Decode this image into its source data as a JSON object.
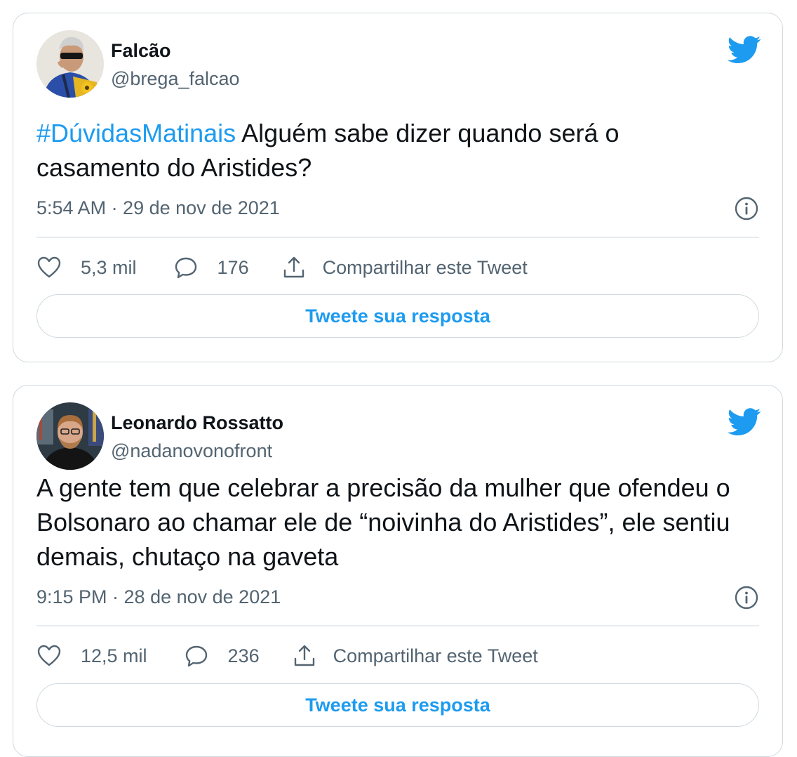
{
  "colors": {
    "accent": "#1d9bf0",
    "text": "#0f1419",
    "secondary": "#536471",
    "border": "#cfd9de"
  },
  "tweets": [
    {
      "display_name": "Falcão",
      "handle": "@brega_falcao",
      "avatar_icon": "avatar-photo",
      "hashtag": "#DúvidasMatinais",
      "text": " Alguém  sabe dizer quando será o casamento do Aristides?",
      "timestamp": "5:54 AM · 29 de nov de 2021",
      "likes": "5,3 mil",
      "replies": "176",
      "share_label": "Compartilhar este Tweet",
      "reply_button": "Tweete sua resposta"
    },
    {
      "display_name": "Leonardo Rossatto",
      "handle": "@nadanovonofront",
      "avatar_icon": "avatar-photo",
      "hashtag": "",
      "text": "A gente tem que celebrar a precisão da mulher que ofendeu o Bolsonaro ao chamar ele de “noivinha do Aristides”, ele sentiu demais, chutaço na gaveta",
      "timestamp": "9:15 PM · 28 de nov de 2021",
      "likes": "12,5 mil",
      "replies": "236",
      "share_label": "Compartilhar este Tweet",
      "reply_button": "Tweete sua resposta"
    }
  ]
}
